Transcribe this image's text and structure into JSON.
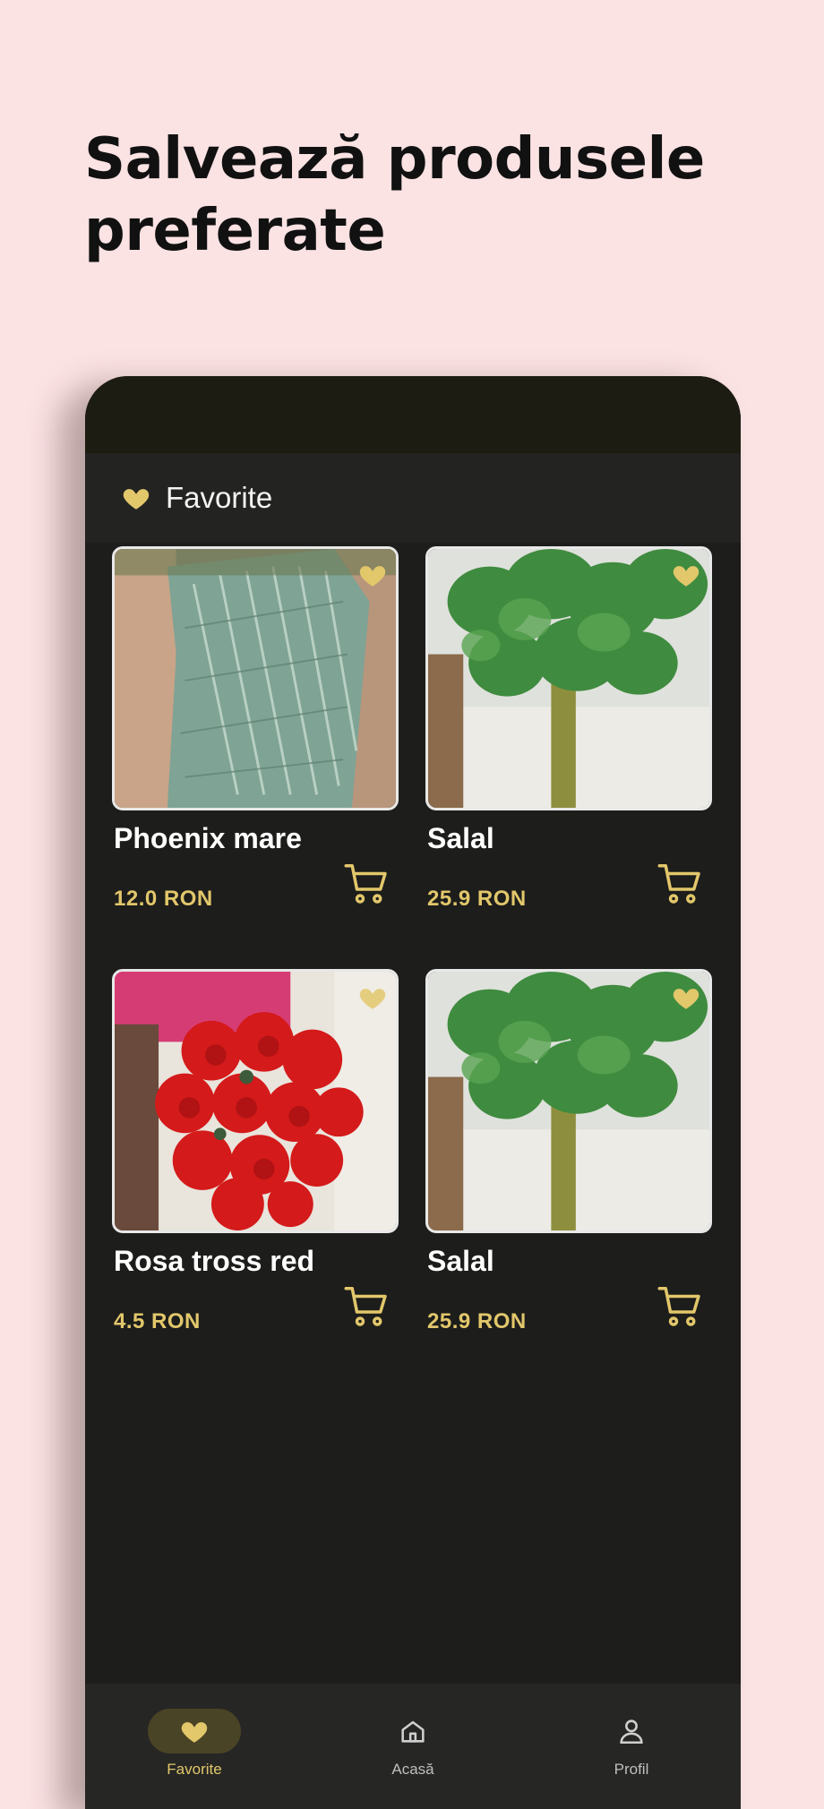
{
  "headline": "Salvează produsele preferate",
  "appbar": {
    "title": "Favorite",
    "icon": "heart-icon"
  },
  "products": [
    {
      "name": "Phoenix mare",
      "price": "12.0 RON",
      "image": "phoenix-foliage"
    },
    {
      "name": "Salal",
      "price": "25.9 RON",
      "image": "salal-greens"
    },
    {
      "name": "Rosa tross red",
      "price": "4.5 RON",
      "image": "red-roses"
    },
    {
      "name": "Salal",
      "price": "25.9 RON",
      "image": "salal-greens"
    }
  ],
  "nav": [
    {
      "label": "Favorite",
      "icon": "heart-icon",
      "active": true
    },
    {
      "label": "Acasă",
      "icon": "home-icon",
      "active": false
    },
    {
      "label": "Profil",
      "icon": "user-icon",
      "active": false
    }
  ],
  "colors": {
    "background": "#fbe2e3",
    "app_bg": "#1d1d1b",
    "accent_gold": "#e2c76b",
    "text_primary": "#ffffff"
  }
}
